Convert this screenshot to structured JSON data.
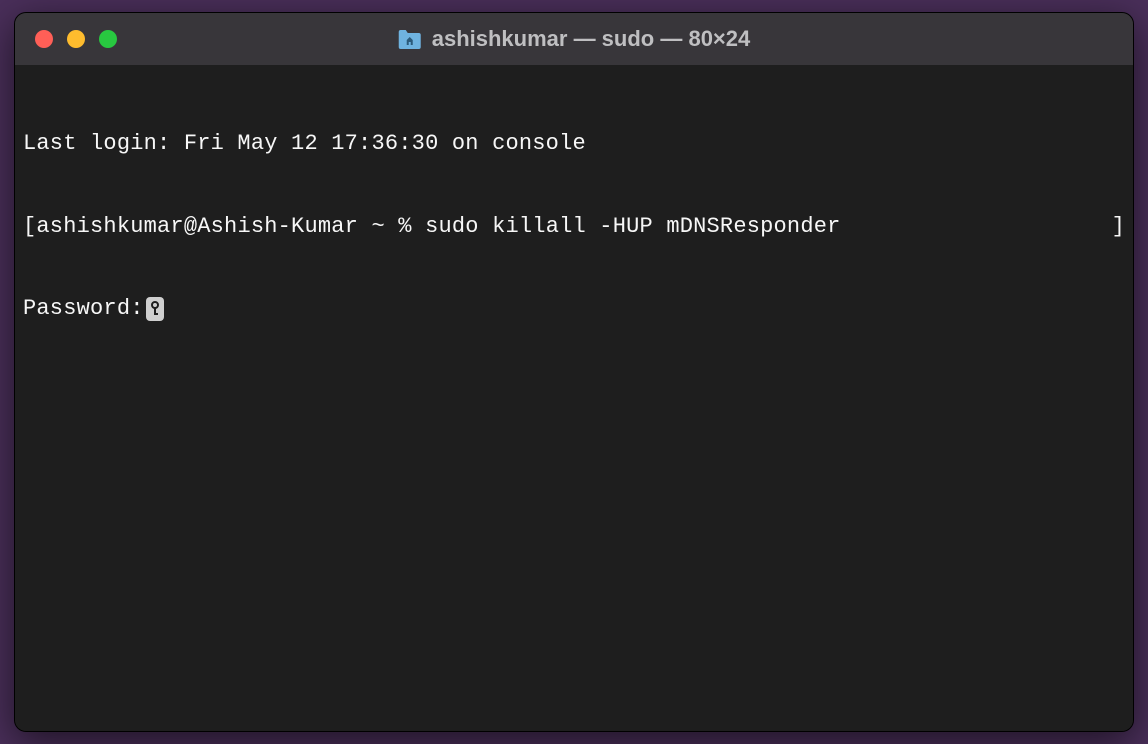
{
  "titlebar": {
    "title": "ashishkumar — sudo — 80×24",
    "icon": "folder-home-icon"
  },
  "terminal": {
    "last_login": "Last login: Fri May 12 17:36:30 on console",
    "prompt_open_bracket": "[",
    "prompt_text": "ashishkumar@Ashish-Kumar ~ % ",
    "command": "sudo killall -HUP mDNSResponder",
    "prompt_close_bracket": "]",
    "password_label": "Password:"
  }
}
